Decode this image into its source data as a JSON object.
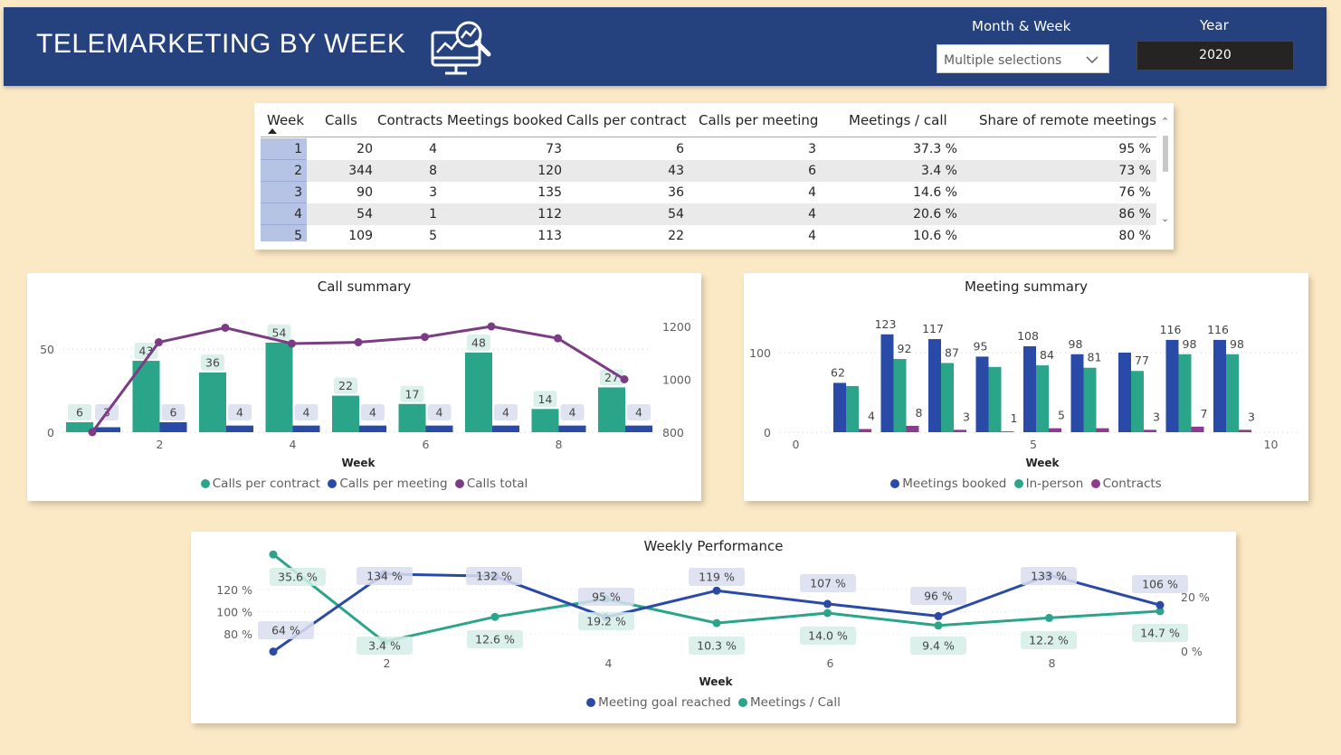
{
  "header": {
    "title": "TELEMARKETING BY WEEK",
    "logo_icon": "monitor-analytics-icon",
    "month_week_label": "Month & Week",
    "month_week_value": "Multiple selections",
    "year_label": "Year",
    "year_value": "2020",
    "colors": {
      "header_bg": "#25427f",
      "page_bg": "#fbe8c4"
    }
  },
  "table": {
    "columns": [
      "Week",
      "Calls",
      "Contracts",
      "Meetings booked",
      "Calls per contract",
      "Calls per meeting",
      "Meetings / call",
      "Share of remote meetings"
    ],
    "rows": [
      [
        "1",
        "20",
        "4",
        "73",
        "6",
        "3",
        "37.3 %",
        "95 %"
      ],
      [
        "2",
        "344",
        "8",
        "120",
        "43",
        "6",
        "3.4 %",
        "73 %"
      ],
      [
        "3",
        "90",
        "3",
        "135",
        "36",
        "4",
        "14.6 %",
        "76 %"
      ],
      [
        "4",
        "54",
        "1",
        "112",
        "54",
        "4",
        "20.6 %",
        "86 %"
      ],
      [
        "5",
        "109",
        "5",
        "113",
        "22",
        "4",
        "10.6 %",
        "80 %"
      ]
    ]
  },
  "chart_data": [
    {
      "type": "bar",
      "title": "Call summary",
      "xlabel": "Week",
      "x": [
        1,
        2,
        3,
        4,
        5,
        6,
        7,
        8,
        9
      ],
      "x_ticks": [
        "2",
        "4",
        "6",
        "8"
      ],
      "y_left_ticks": [
        "0",
        "50"
      ],
      "y_left_lim": [
        0,
        70
      ],
      "y_right_ticks": [
        "800",
        "1000",
        "1200"
      ],
      "y_right_lim": [
        800,
        1200
      ],
      "series": [
        {
          "name": "Calls per contract",
          "type": "bar",
          "axis": "left",
          "color": "#2aa58a",
          "values": [
            6,
            43,
            36,
            54,
            22,
            17,
            48,
            14,
            27
          ],
          "labels": [
            "6",
            "43",
            "36",
            "54",
            "22",
            "17",
            "48",
            "14",
            "27"
          ]
        },
        {
          "name": "Calls per meeting",
          "type": "bar",
          "axis": "left",
          "color": "#2a4aa8",
          "values": [
            3,
            6,
            4,
            4,
            4,
            4,
            4,
            4,
            4
          ],
          "labels": [
            "3",
            "6",
            "4",
            "4",
            "4",
            "4",
            "4",
            "4",
            "4"
          ]
        },
        {
          "name": "Calls total",
          "type": "line",
          "axis": "right",
          "color": "#7c3c85",
          "values": [
            800,
            1140,
            1195,
            1135,
            1140,
            1160,
            1200,
            1155,
            1000
          ]
        }
      ],
      "legend": "bottom",
      "grid": true
    },
    {
      "type": "bar",
      "title": "Meeting summary",
      "xlabel": "Week",
      "x": [
        1,
        2,
        3,
        4,
        5,
        6,
        7,
        8,
        9
      ],
      "x_ticks": [
        "0",
        "5",
        "10"
      ],
      "y_ticks": [
        "0",
        "100"
      ],
      "ylim": [
        0,
        130
      ],
      "series": [
        {
          "name": "Meetings booked",
          "color": "#2a4aa8",
          "values": [
            62,
            123,
            117,
            95,
            108,
            98,
            100,
            116,
            116
          ],
          "labels": [
            "62",
            "123",
            "117",
            "95",
            "108",
            "98",
            "",
            "116",
            "116"
          ]
        },
        {
          "name": "In-person",
          "color": "#2aa58a",
          "values": [
            58,
            92,
            87,
            82,
            84,
            81,
            77,
            98,
            98
          ],
          "labels": [
            "",
            "92",
            "87",
            "",
            "84",
            "81",
            "77",
            "98",
            "98"
          ]
        },
        {
          "name": "Contracts",
          "color": "#8e3a8e",
          "values": [
            4,
            8,
            3,
            1,
            5,
            5,
            3,
            7,
            3
          ],
          "labels": [
            "4",
            "8",
            "3",
            "1",
            "5",
            "",
            "3",
            "7",
            "3"
          ]
        }
      ],
      "legend": "bottom",
      "grid": true
    },
    {
      "type": "line",
      "title": "Weekly Performance",
      "xlabel": "Week",
      "x": [
        1,
        2,
        3,
        4,
        5,
        6,
        7,
        8,
        9
      ],
      "x_ticks": [
        "2",
        "4",
        "6",
        "8"
      ],
      "y_left_ticks": [
        "80 %",
        "100 %",
        "120 %"
      ],
      "y_left_lim": [
        60,
        140
      ],
      "y_right_ticks": [
        "0 %",
        "20 %"
      ],
      "y_right_lim": [
        0,
        40
      ],
      "series": [
        {
          "name": "Meeting goal reached",
          "axis": "left",
          "color": "#2a4aa8",
          "values": [
            64,
            134,
            132,
            95,
            119,
            107,
            96,
            133,
            106
          ],
          "labels": [
            "64 %",
            "134 %",
            "132 %",
            "95 %",
            "119 %",
            "107 %",
            "96 %",
            "133 %",
            "106 %"
          ]
        },
        {
          "name": "Meetings / Call",
          "axis": "right",
          "color": "#2aa58a",
          "values": [
            35.6,
            3.4,
            12.6,
            19.2,
            10.3,
            14.0,
            9.4,
            12.2,
            14.7
          ],
          "labels": [
            "35.6 %",
            "3.4 %",
            "12.6 %",
            "19.2 %",
            "10.3 %",
            "14.0 %",
            "9.4 %",
            "12.2 %",
            "14.7 %"
          ]
        }
      ],
      "legend": "bottom",
      "grid": true
    }
  ]
}
